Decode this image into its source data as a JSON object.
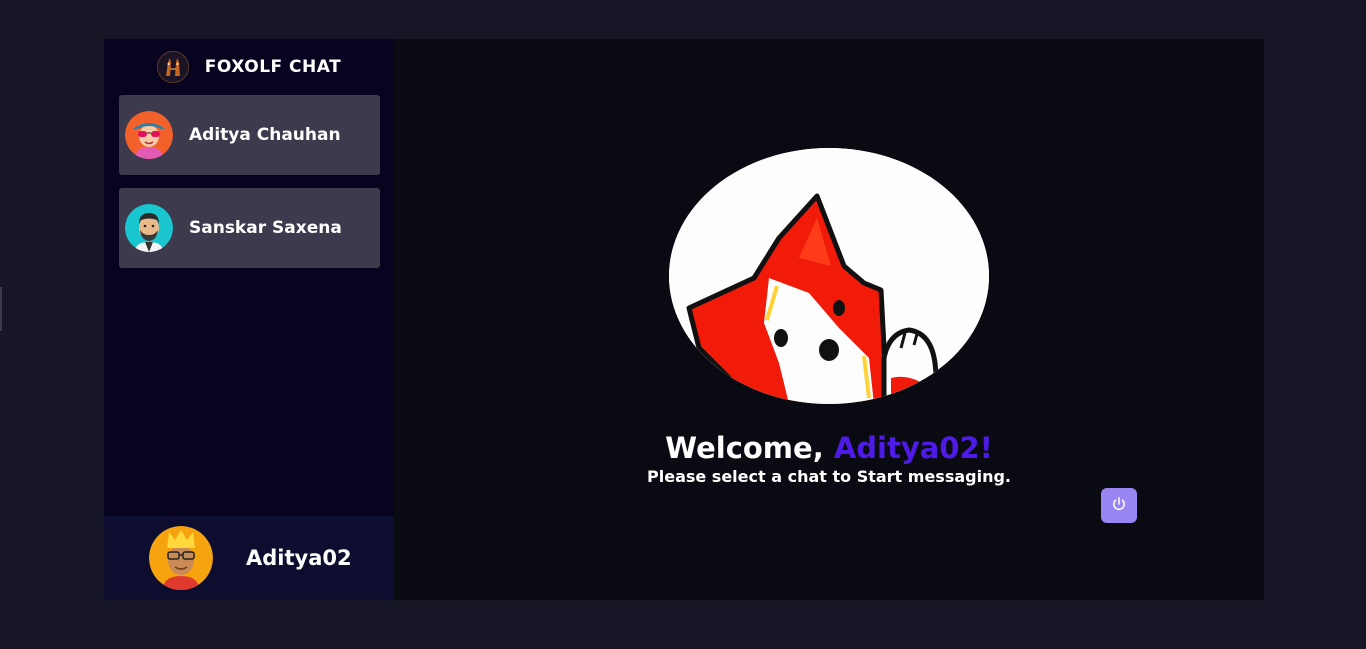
{
  "brand": {
    "title": "FOXOLF CHAT",
    "logo_icon": "foxolf-logo-icon"
  },
  "contacts": [
    {
      "name": "Aditya Chauhan",
      "avatar": "woman-sunglasses-avatar"
    },
    {
      "name": "Sanskar Saxena",
      "avatar": "bearded-man-avatar"
    }
  ],
  "current_user": {
    "name": "Aditya02",
    "avatar": "crowned-man-avatar"
  },
  "welcome": {
    "greeting": "Welcome, ",
    "username": "Aditya02!",
    "subtitle": "Please select a chat to Start messaging."
  },
  "logout": {
    "icon": "power-icon"
  },
  "colors": {
    "page_bg": "#171627",
    "sidebar_bg": "#080420",
    "contact_bg": "#3d3a4e",
    "current_user_bg": "#0d0d30",
    "main_bg": "#0a0a12",
    "accent": "#4e1be6",
    "button": "#9a86f3"
  }
}
